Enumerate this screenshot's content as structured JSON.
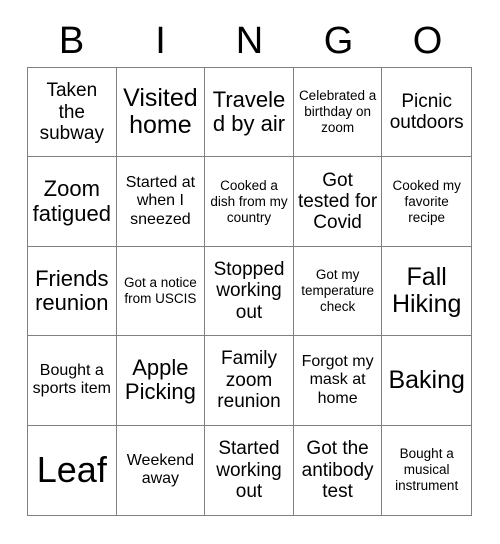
{
  "card": {
    "title": "BINGO",
    "background_color": "#ffffff",
    "text_color": "#000000",
    "border_color": "#808080"
  },
  "header": {
    "letters": [
      {
        "label": "B"
      },
      {
        "label": "I"
      },
      {
        "label": "N"
      },
      {
        "label": "G"
      },
      {
        "label": "O"
      }
    ]
  },
  "grid": {
    "columns": 5,
    "rows": 5,
    "cells": [
      {
        "text": "Taken the subway",
        "size": "md"
      },
      {
        "text": "Visited home",
        "size": "xl"
      },
      {
        "text": "Traveled by air",
        "size": "lg"
      },
      {
        "text": "Celebrated a birthday on zoom",
        "size": "xs"
      },
      {
        "text": "Picnic outdoors",
        "size": "md"
      },
      {
        "text": "Zoom fatigued",
        "size": "lg"
      },
      {
        "text": "Started at when I sneezed",
        "size": "sm"
      },
      {
        "text": "Cooked a dish from my country",
        "size": "xs"
      },
      {
        "text": "Got tested for Covid",
        "size": "md"
      },
      {
        "text": "Cooked my favorite recipe",
        "size": "xs"
      },
      {
        "text": "Friends reunion",
        "size": "lg"
      },
      {
        "text": "Got a notice from USCIS",
        "size": "xs"
      },
      {
        "text": "Stopped working out",
        "size": "md"
      },
      {
        "text": "Got my temperature check",
        "size": "xs"
      },
      {
        "text": "Fall Hiking",
        "size": "xl"
      },
      {
        "text": "Bought a sports item",
        "size": "sm"
      },
      {
        "text": "Apple Picking",
        "size": "lg"
      },
      {
        "text": "Family zoom reunion",
        "size": "md"
      },
      {
        "text": "Forgot my mask at home",
        "size": "sm"
      },
      {
        "text": "Baking",
        "size": "xl"
      },
      {
        "text": "Leaf",
        "size": "xxl"
      },
      {
        "text": "Weekend away",
        "size": "sm"
      },
      {
        "text": "Started working out",
        "size": "md"
      },
      {
        "text": "Got the antibody test",
        "size": "md"
      },
      {
        "text": "Bought a musical instrument",
        "size": "xs"
      }
    ]
  }
}
